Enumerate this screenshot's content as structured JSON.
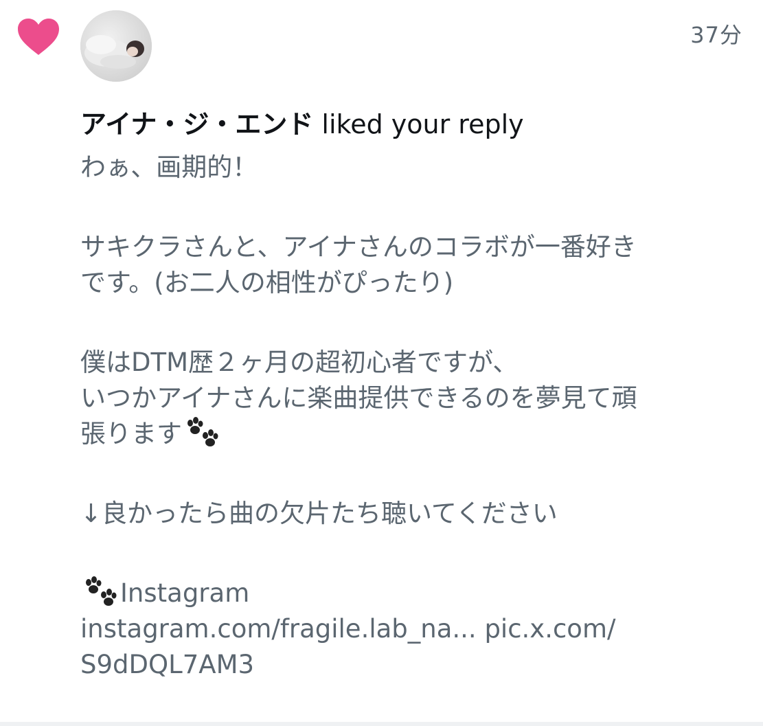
{
  "notification": {
    "timestamp": "37分",
    "user_name": "アイナ・ジ・エンド",
    "action_text": " liked your reply",
    "icons": {
      "status": "heart-icon",
      "emoji": "paw-prints-icon"
    },
    "colors": {
      "heart": "#ec4d8c",
      "body_text": "#5b6670",
      "headline_text": "#111418"
    },
    "reply": {
      "line1": "わぁ、画期的！",
      "line2": "サキクラさんと、アイナさんのコラボが一番好き",
      "line3": "です。(お二人の相性がぴったり)",
      "line4": "僕はDTM歴２ヶ月の超初心者ですが、",
      "line5": "いつかアイナさんに楽曲提供できるのを夢見て頑",
      "line6": "張ります",
      "line7": "↓良かったら曲の欠片たち聴いてください",
      "line8": "Instagram",
      "line9": "instagram.com/fragile.lab_na... pic.x.com/",
      "line10": "S9dDQL7AM3"
    }
  }
}
